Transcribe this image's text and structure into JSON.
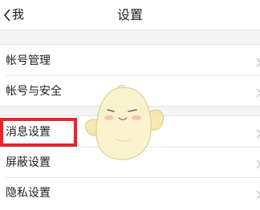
{
  "header": {
    "back_label": "我",
    "title": "设置"
  },
  "sections": [
    {
      "items": [
        {
          "label": "帐号管理"
        },
        {
          "label": "帐号与安全"
        }
      ]
    },
    {
      "items": [
        {
          "label": "消息设置"
        },
        {
          "label": "屏蔽设置"
        },
        {
          "label": "隐私设置"
        }
      ]
    }
  ],
  "highlight_color": "#e3262e",
  "icons": {
    "back": "chevron-left-icon",
    "row_arrow": "chevron-right-icon",
    "overlay": "mascot-sticker"
  }
}
